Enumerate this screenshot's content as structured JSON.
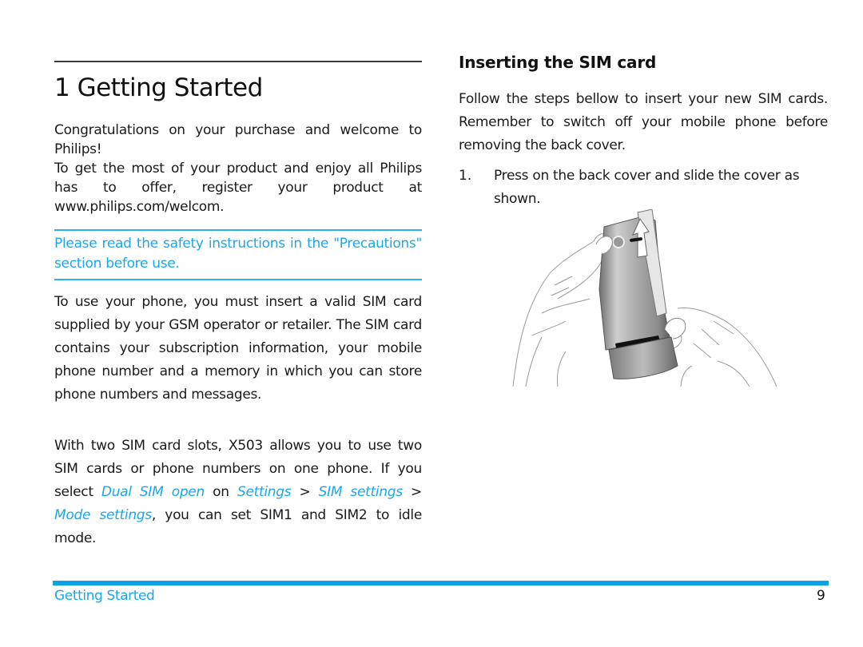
{
  "chapter": {
    "title": "1 Getting Started"
  },
  "intro": {
    "line1": "Congratulations on your purchase and welcome to Philips!",
    "line2": "To get the most of your product and enjoy all Philips has to offer, register your product at www.philips.com/welcom."
  },
  "notice": {
    "text": "Please read the safety instructions in the \"Precautions\" section before use."
  },
  "sim_info": {
    "text": "To use your phone, you must insert a valid SIM card supplied by your GSM operator or retailer. The SIM card contains your subscription information, your mobile phone number and a memory in which you can store phone numbers and messages."
  },
  "dual_sim": {
    "part1": "With two SIM card slots, X503 allows you to use two SIM cards or phone numbers on one phone. If you select ",
    "link1": "Dual SIM open",
    "part2": " on ",
    "link2": "Settings",
    "sep1": " > ",
    "link3": "SIM settings",
    "sep2": " > ",
    "link4": "Mode settings",
    "part3": ", you can set SIM1 and SIM2 to idle mode."
  },
  "inserting": {
    "title": "Inserting the SIM card",
    "intro": "Follow the steps bellow to insert your new SIM cards. Remember to switch off your mobile phone before removing the back cover.",
    "steps": [
      {
        "number": "1.",
        "text": "Press on the back cover and slide the cover as shown."
      }
    ],
    "illustration": {
      "icon": "phone-back-cover-slide-illustration",
      "alt": "Hands sliding the back cover off the phone"
    }
  },
  "footer": {
    "section": "Getting Started",
    "page_number": "9"
  },
  "colors": {
    "accent": "#1aa7ec",
    "footer_bar": "#0aa3ea",
    "rule": "#3a3a3a",
    "text": "#1a1a1a"
  }
}
